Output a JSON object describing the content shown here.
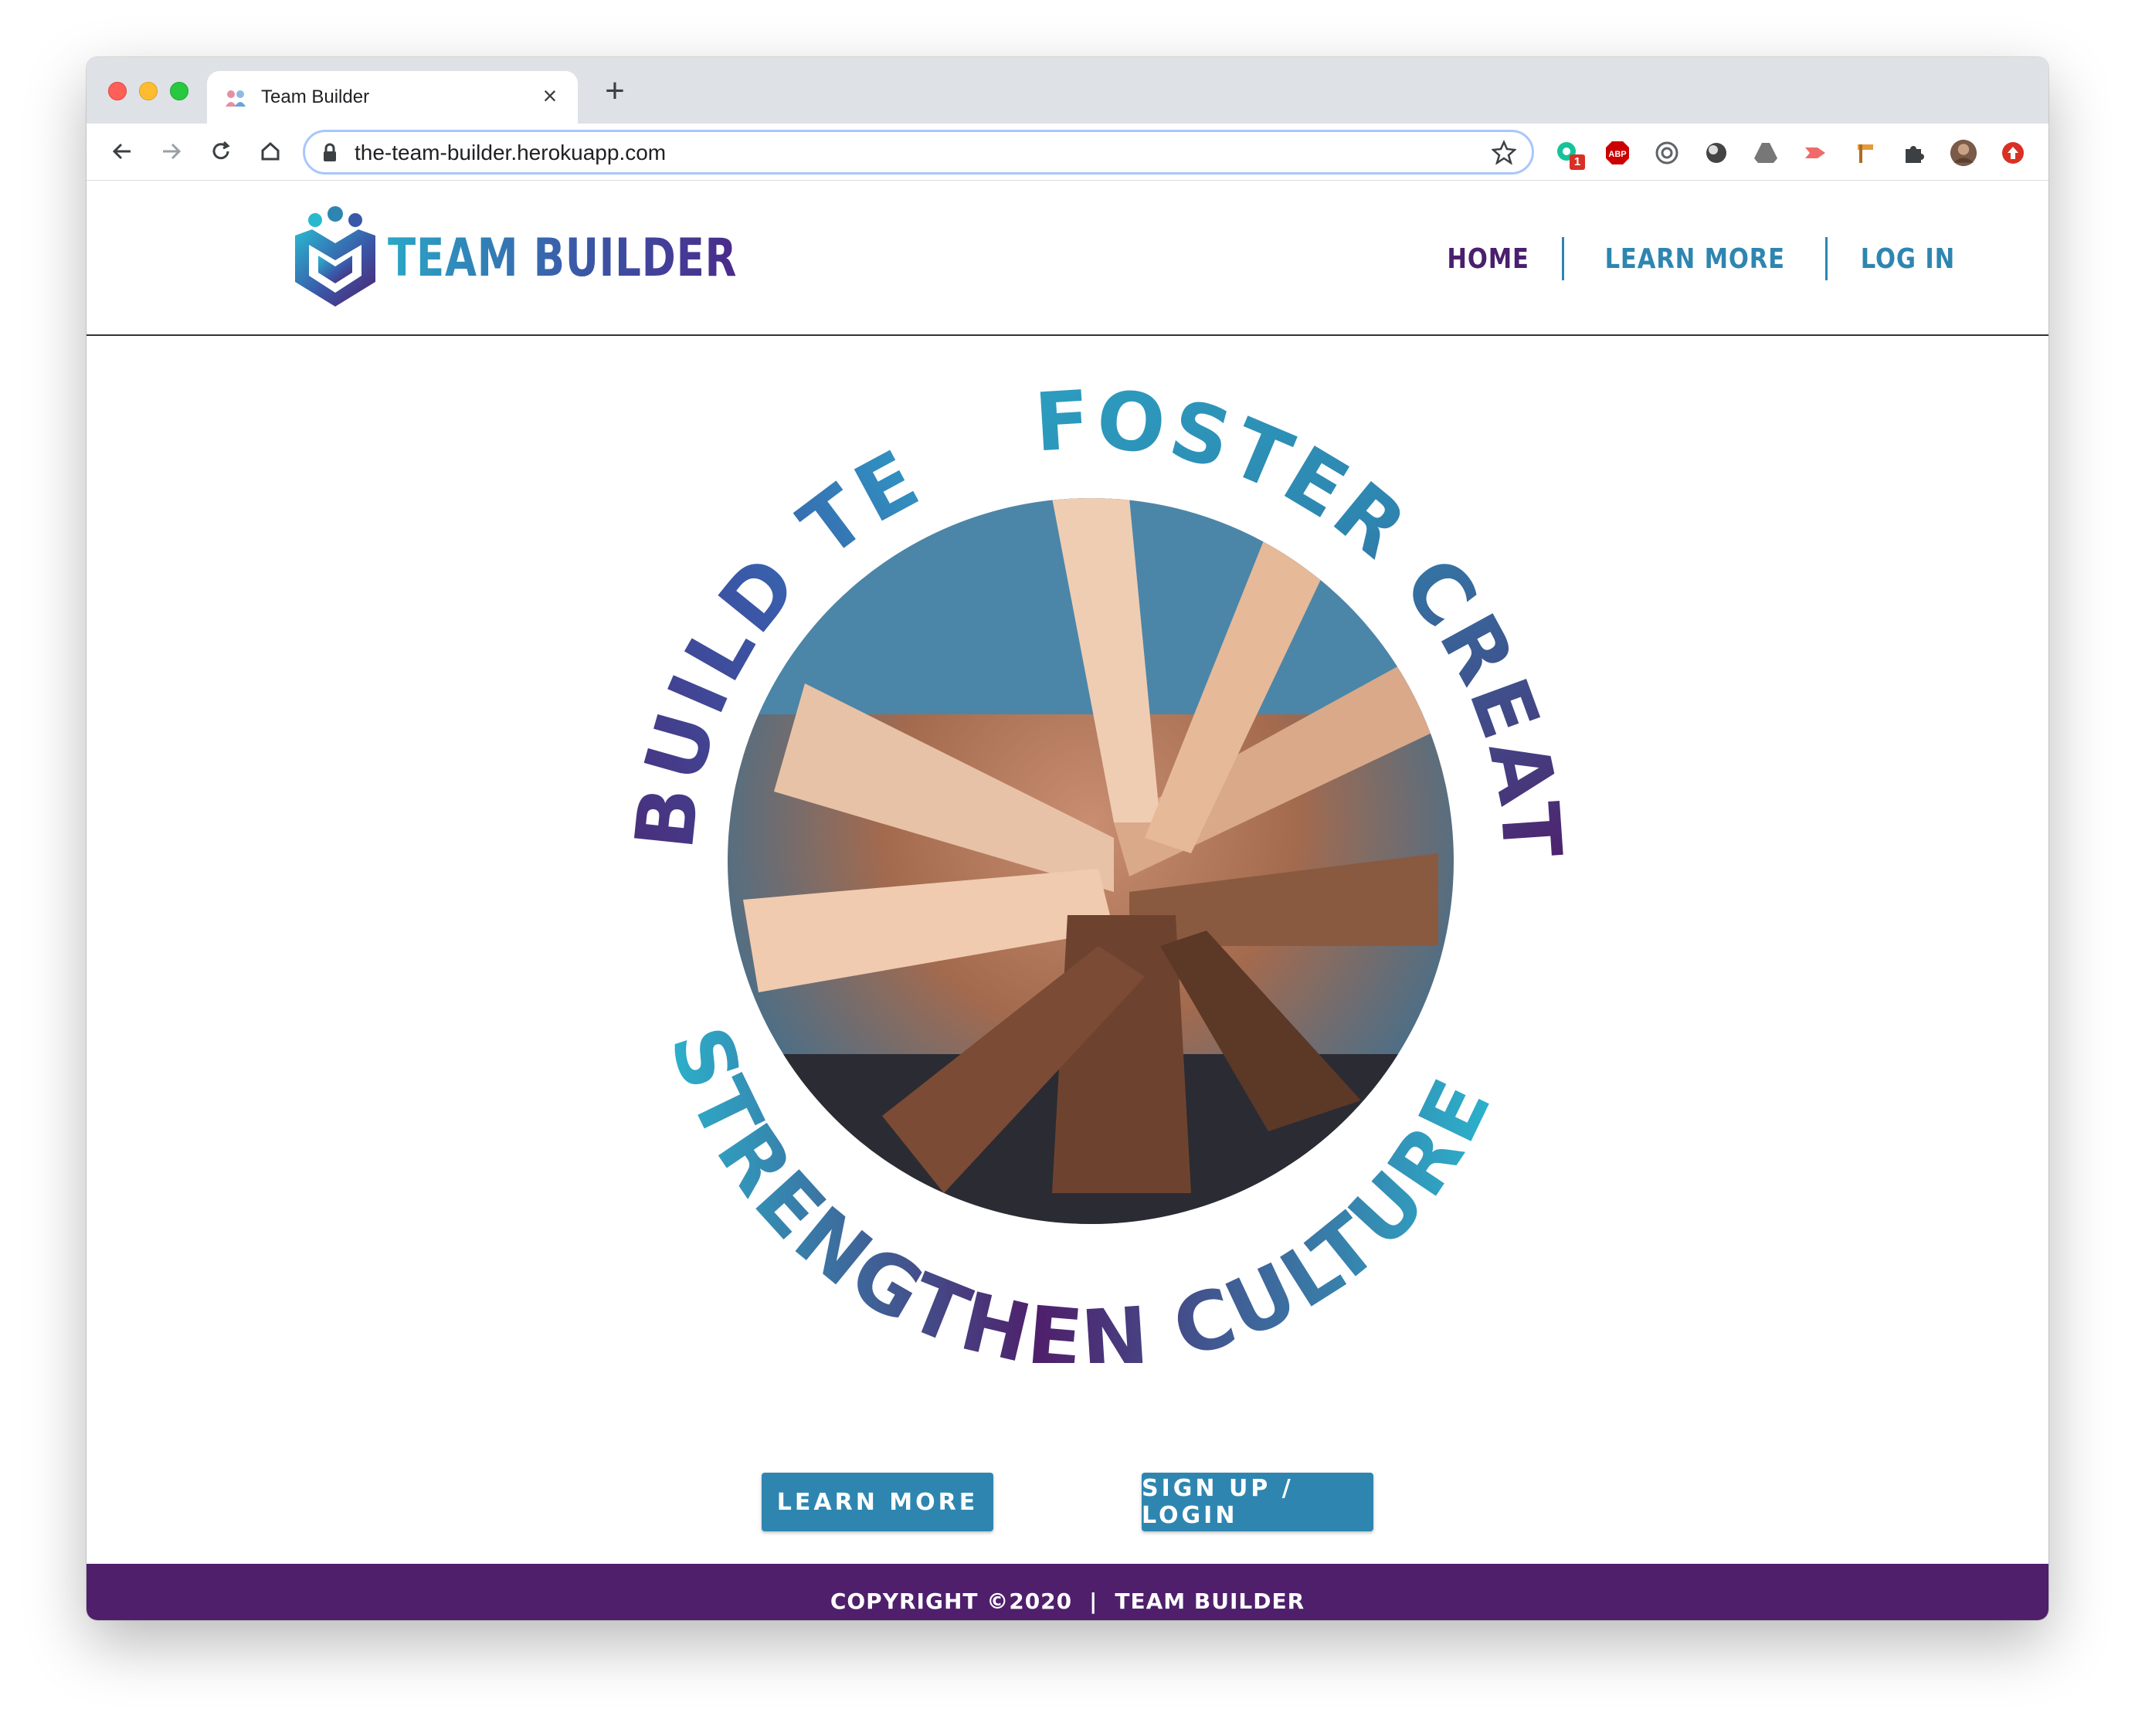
{
  "browser": {
    "tab_title": "Team Builder",
    "tab_close": "×",
    "new_tab": "+",
    "url": "the-team-builder.herokuapp.com",
    "extension_badge": "1",
    "extensions": [
      "grammarly-icon",
      "adblock-icon",
      "privacy-icon",
      "dark-reader-icon",
      "drive-icon",
      "cast-icon",
      "signpost-icon",
      "puzzle-icon",
      "profile-avatar",
      "update-icon"
    ]
  },
  "site": {
    "brand_name": "TEAM BUILDER",
    "nav": {
      "home": "HOME",
      "learn_more": "LEARN MORE",
      "log_in": "LOG IN"
    },
    "hero": {
      "arc_top_left": "BUILD TEAMS",
      "arc_top_right": "FOSTER CREATIVITY",
      "arc_bottom": "STRENGTHEN CULTURE"
    },
    "buttons": {
      "learn_more": "LEARN MORE",
      "sign_up": "SIGN UP / LOGIN"
    },
    "footer": {
      "copyright": "COPYRIGHT ©2020",
      "separator": "|",
      "brand": "TEAM BUILDER"
    }
  },
  "colors": {
    "purple": "#4f1f6b",
    "teal": "#2e86b0",
    "cyan": "#2ab8d0"
  }
}
